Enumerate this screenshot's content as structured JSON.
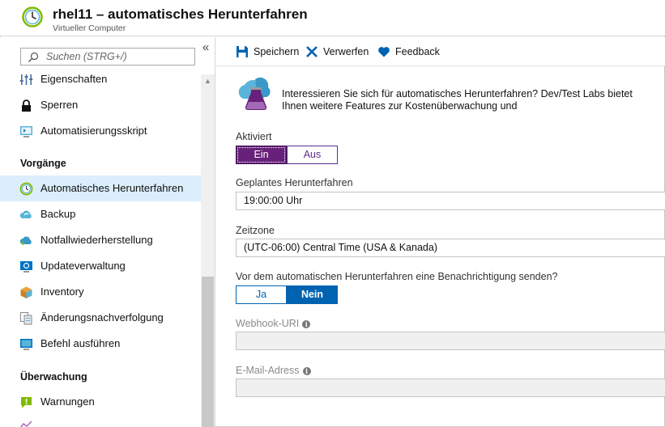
{
  "header": {
    "title": "rhel11 – automatisches Herunterfahren",
    "subtitle": "Virtueller Computer"
  },
  "sidebar": {
    "search_placeholder": "Suchen (STRG+/)",
    "collapse_label": "«",
    "items": [
      {
        "label": "Eigenschaften",
        "icon": "properties-icon"
      },
      {
        "label": "Sperren",
        "icon": "lock-icon"
      },
      {
        "label": "Automatisierungsskript",
        "icon": "script-icon"
      }
    ],
    "sections": [
      {
        "title": "Vorgänge",
        "items": [
          {
            "label": "Automatisches Herunterfahren",
            "icon": "clock-icon",
            "active": true
          },
          {
            "label": "Backup",
            "icon": "cloud-backup-icon"
          },
          {
            "label": "Notfallwiederherstellung",
            "icon": "cloud-recovery-icon"
          },
          {
            "label": "Updateverwaltung",
            "icon": "update-icon"
          },
          {
            "label": "Inventory",
            "icon": "package-icon"
          },
          {
            "label": "Änderungsnachverfolgung",
            "icon": "change-tracking-icon"
          },
          {
            "label": "Befehl ausführen",
            "icon": "run-command-icon"
          }
        ]
      },
      {
        "title": "Überwachung",
        "items": [
          {
            "label": "Warnungen",
            "icon": "alert-icon"
          }
        ]
      }
    ]
  },
  "toolbar": {
    "save_label": "Speichern",
    "discard_label": "Verwerfen",
    "feedback_label": "Feedback"
  },
  "main": {
    "promo_text": "Interessieren Sie sich für automatisches Herunterfahren? Dev/Test Labs bietet Ihnen weitere Features zur Kostenüberwachung und",
    "enabled_label": "Aktiviert",
    "enabled_on": "Ein",
    "enabled_off": "Aus",
    "enabled_value": "Ein",
    "scheduled_label": "Geplantes Herunterfahren",
    "scheduled_value": "19:00:00 Uhr",
    "timezone_label": "Zeitzone",
    "timezone_value": "(UTC-06:00) Central Time (USA & Kanada)",
    "notify_label": "Vor dem automatischen Herunterfahren eine Benachrichtigung senden?",
    "notify_yes": "Ja",
    "notify_no": "Nein",
    "notify_value": "Nein",
    "webhook_label": "Webhook-URI",
    "webhook_value": "",
    "email_label": "E-Mail-Adress",
    "email_value": "",
    "info_glyph": "i"
  },
  "colors": {
    "accent_purple": "#68217a",
    "accent_blue": "#0063b1",
    "active_nav_bg": "#dbeefb"
  }
}
